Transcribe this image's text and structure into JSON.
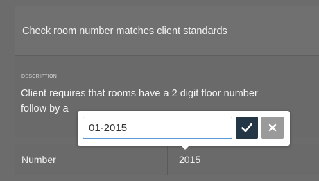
{
  "task": {
    "title": "Check room number matches client standards"
  },
  "description": {
    "label": "DESCRIPTION",
    "line1": "Client requires that rooms have a 2 digit floor number",
    "line2": "follow by a"
  },
  "field": {
    "label": "Number",
    "value": "2015"
  },
  "editor": {
    "input_value": "01-2015",
    "confirm_icon": "check-icon",
    "cancel_icon": "close-icon",
    "input_border_color": "#5b9bd5",
    "confirm_color": "#243746",
    "cancel_color": "#9a9a9a"
  }
}
